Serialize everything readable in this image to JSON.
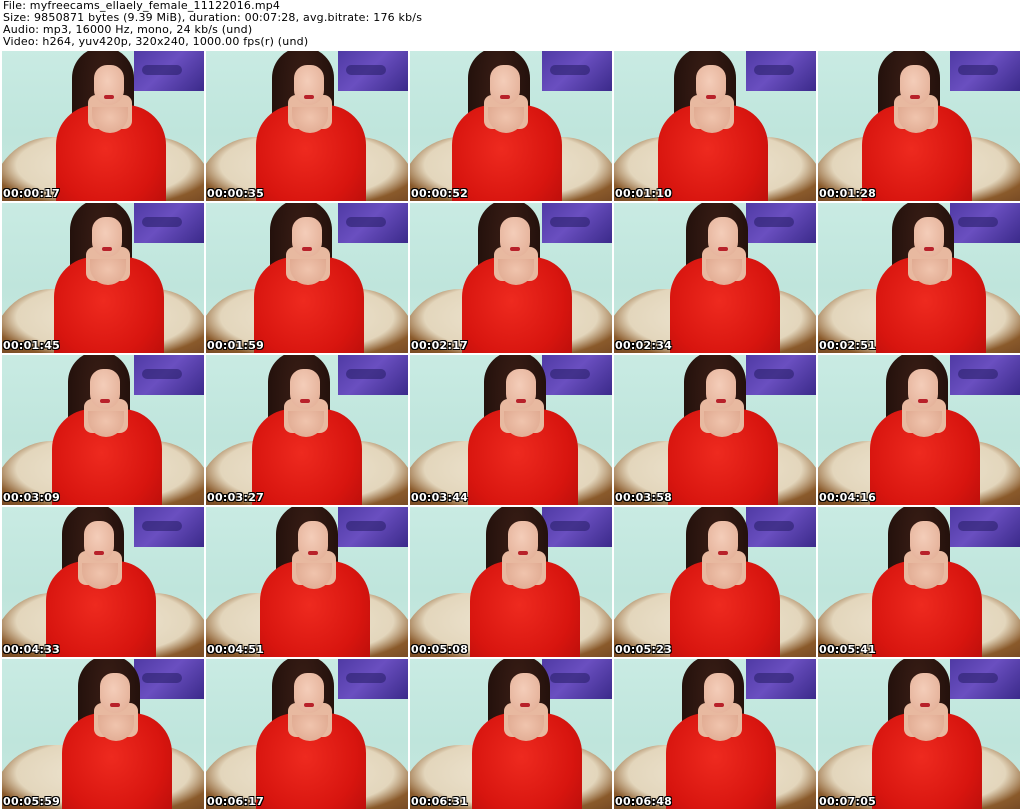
{
  "header": {
    "file": "File: myfreecams_ellaely_female_11122016.mp4",
    "size": "Size: 9850871 bytes (9.39 MiB), duration: 00:07:28, avg.bitrate: 176 kb/s",
    "audio": "Audio: mp3, 16000 Hz, mono, 24 kb/s (und)",
    "video": "Video: h264, yuv420p, 320x240, 1000.00 fps(r) (und)"
  },
  "thumbnails": [
    {
      "timestamp": "00:00:17"
    },
    {
      "timestamp": "00:00:35"
    },
    {
      "timestamp": "00:00:52"
    },
    {
      "timestamp": "00:01:10"
    },
    {
      "timestamp": "00:01:28"
    },
    {
      "timestamp": "00:01:45"
    },
    {
      "timestamp": "00:01:59"
    },
    {
      "timestamp": "00:02:17"
    },
    {
      "timestamp": "00:02:34"
    },
    {
      "timestamp": "00:02:51"
    },
    {
      "timestamp": "00:03:09"
    },
    {
      "timestamp": "00:03:27"
    },
    {
      "timestamp": "00:03:44"
    },
    {
      "timestamp": "00:03:58"
    },
    {
      "timestamp": "00:04:16"
    },
    {
      "timestamp": "00:04:33"
    },
    {
      "timestamp": "00:04:51"
    },
    {
      "timestamp": "00:05:08"
    },
    {
      "timestamp": "00:05:23"
    },
    {
      "timestamp": "00:05:41"
    },
    {
      "timestamp": "00:05:59"
    },
    {
      "timestamp": "00:06:17"
    },
    {
      "timestamp": "00:06:31"
    },
    {
      "timestamp": "00:06:48"
    },
    {
      "timestamp": "00:07:05"
    }
  ]
}
